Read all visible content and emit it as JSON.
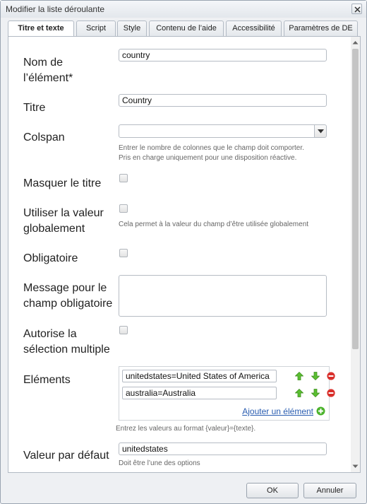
{
  "window": {
    "title": "Modifier la liste déroulante"
  },
  "tabs": [
    {
      "label": "Titre et texte",
      "active": true
    },
    {
      "label": "Script"
    },
    {
      "label": "Style"
    },
    {
      "label": "Contenu de l’aide"
    },
    {
      "label": "Accessibilité"
    },
    {
      "label": "Paramètres de DE"
    }
  ],
  "form": {
    "name": {
      "label_line1": "Nom de",
      "label_line2": "l’élément*",
      "value": "country"
    },
    "title": {
      "label": "Titre",
      "value": "Country"
    },
    "colspan": {
      "label": "Colspan",
      "value": "",
      "hint_line1": "Entrer le nombre de colonnes que le champ doit comporter.",
      "hint_line2": "Pris en charge uniquement pour une disposition réactive."
    },
    "hide_title": {
      "label": "Masquer le titre",
      "checked": false
    },
    "use_globally": {
      "label_line1": "Utiliser la valeur",
      "label_line2": "globalement",
      "checked": false,
      "hint": "Cela permet à la valeur du champ d’être utilisée globalement"
    },
    "required": {
      "label": "Obligatoire",
      "checked": false
    },
    "required_message": {
      "label_line1": "Message pour le",
      "label_line2": "champ obligatoire",
      "value": ""
    },
    "multi_select": {
      "label_line1": "Autorise la",
      "label_line2": "sélection multiple",
      "checked": false
    },
    "items": {
      "label": "Eléments",
      "values": [
        "unitedstates=United States of America",
        "australia=Australia"
      ],
      "add_link": "Ajouter un élément",
      "hint": "Entrez les valeurs au format {valeur}={texte}."
    },
    "default_value": {
      "label": "Valeur par défaut",
      "value": "unitedstates",
      "hint": "Doit être l’une des options"
    }
  },
  "buttons": {
    "ok": "OK",
    "cancel": "Annuler"
  },
  "colors": {
    "accent": "#2a5db0",
    "up_arrow": "#4caf2c",
    "remove": "#d9302c"
  }
}
